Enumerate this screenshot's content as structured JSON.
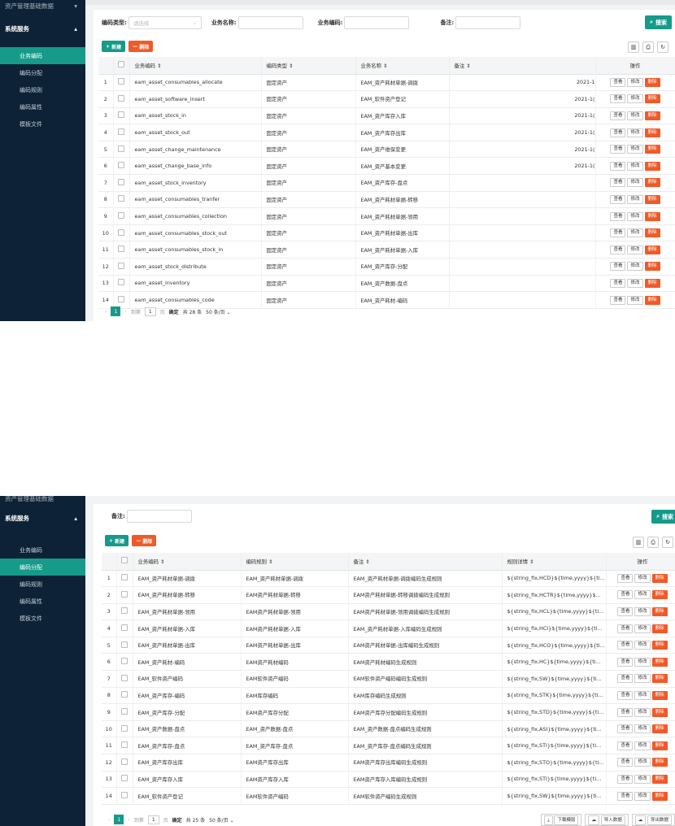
{
  "top": {
    "sidebar": {
      "group_label": "资产管理基础数据",
      "section_label": "系统服务",
      "items": [
        "业务编码",
        "编码分配",
        "编码规则",
        "编码属性",
        "模板文件"
      ],
      "active_index": 0
    },
    "filters": {
      "type_label": "编码类型:",
      "type_placeholder": "请选择",
      "name_label": "业务名称:",
      "code_label": "业务编码:",
      "remark_label": "备注:"
    },
    "search_label": "搜索",
    "add_label": "新建",
    "delete_label": "删除",
    "columns": [
      "业务编码",
      "编码类型",
      "业务名称",
      "备注",
      "",
      "操作"
    ],
    "rows": [
      {
        "n": "1",
        "code": "eam_asset_consumables_allocate",
        "type": "固定资产",
        "name": "EAM_资产耗材单据-调拨",
        "date": "2021-1"
      },
      {
        "n": "2",
        "code": "eam_asset_software_insert",
        "type": "固定资产",
        "name": "EAM_软件资产登记",
        "date": "2021-1("
      },
      {
        "n": "3",
        "code": "eam_asset_stock_in",
        "type": "固定资产",
        "name": "EAM_资产库存入库",
        "date": "2021-1("
      },
      {
        "n": "4",
        "code": "eam_asset_stock_out",
        "type": "固定资产",
        "name": "EAM_资产库存出库",
        "date": "2021-1("
      },
      {
        "n": "5",
        "code": "eam_asset_change_maintenance",
        "type": "固定资产",
        "name": "EAM_资产维保变更",
        "date": "2021-1("
      },
      {
        "n": "6",
        "code": "eam_asset_change_base_info",
        "type": "固定资产",
        "name": "EAM_资产基本变更",
        "date": "2021-1("
      },
      {
        "n": "7",
        "code": "eam_asset_stock_inventory",
        "type": "固定资产",
        "name": "EAM_资产库存-盘点",
        "date": ""
      },
      {
        "n": "8",
        "code": "eam_asset_consumables_tranfer",
        "type": "固定资产",
        "name": "EAM_资产耗材单据-转移",
        "date": ""
      },
      {
        "n": "9",
        "code": "eam_asset_consumables_collection",
        "type": "固定资产",
        "name": "EAM_资产耗材单据-领用",
        "date": ""
      },
      {
        "n": "10",
        "code": "eam_asset_consumables_stock_out",
        "type": "固定资产",
        "name": "EAM_资产耗材单据-出库",
        "date": ""
      },
      {
        "n": "11",
        "code": "eam_asset_consumables_stock_in",
        "type": "固定资产",
        "name": "EAM_资产耗材单据-入库",
        "date": ""
      },
      {
        "n": "12",
        "code": "eam_asset_stock_distribute",
        "type": "固定资产",
        "name": "EAM_资产库存-分配",
        "date": ""
      },
      {
        "n": "13",
        "code": "eam_asset_inventory",
        "type": "固定资产",
        "name": "EAM_资产数据-盘点",
        "date": ""
      },
      {
        "n": "14",
        "code": "eam_asset_consumables_code",
        "type": "固定资产",
        "name": "EAM_资产耗材-编码",
        "date": ""
      }
    ],
    "op_view": "查看",
    "op_edit": "修改",
    "op_delete": "删除",
    "pager": {
      "page": "1",
      "goto": "到第",
      "page_input": "1",
      "page_unit": "页",
      "confirm": "确定",
      "total": "共 28 条",
      "size": "50 条/页"
    }
  },
  "bottom": {
    "sidebar": {
      "group_label": "资产管理基础数据",
      "section_label": "系统服务",
      "items": [
        "业务编码",
        "编码分配",
        "编码规则",
        "编码属性",
        "模板文件"
      ],
      "active_index": 1
    },
    "filters": {
      "remark_label": "备注:"
    },
    "search_label": "搜索",
    "add_label": "新建",
    "delete_label": "删除",
    "columns": [
      "业务编码",
      "编码规则",
      "备注",
      "规则详情",
      "操作"
    ],
    "rows": [
      {
        "n": "1",
        "code": "EAM_资产耗材单据-调拨",
        "rule": "EAM_资产耗材单据-调拨",
        "remark": "EAM_资产耗材单据-调拨编码生成规则",
        "detail": "${string_fix,HCD}${time,yyyy}${ti..."
      },
      {
        "n": "2",
        "code": "EAM_资产耗材单据-转移",
        "rule": "EAM资产耗材单据-转移",
        "remark": "EAM资产耗材单据-转移调拨编码生成规则",
        "detail": "${string_fix,HCTR}${time,yyyy}$..."
      },
      {
        "n": "3",
        "code": "EAM_资产耗材单据-领用",
        "rule": "EAM资产耗材单据-领用",
        "remark": "EAM资产耗材单据-领用调拨编码生成规则",
        "detail": "${string_fix,HCL}${time,yyyy}${ti..."
      },
      {
        "n": "4",
        "code": "EAM_资产耗材单据-入库",
        "rule": "EAM资产耗材单据-入库",
        "remark": "EAM_资产耗材单据-入库编码生成规则",
        "detail": "${string_fix,HCI}${time,yyyy}${ti..."
      },
      {
        "n": "5",
        "code": "EAM_资产耗材单据-出库",
        "rule": "EAM资产耗材单据-出库",
        "remark": "EAM资产耗材单据-出库编码生成规则",
        "detail": "${string_fix,HCO}${time,yyyy}${ti..."
      },
      {
        "n": "6",
        "code": "EAM_资产耗材-编码",
        "rule": "EAM资产耗材编码",
        "remark": "EAM资产耗材编码生成规则",
        "detail": "${string_fix,HC}${time,yyyy}${ti..."
      },
      {
        "n": "7",
        "code": "EAM_软件资产编码",
        "rule": "EAM软件资产编码",
        "remark": "EAM软件资产编码编码生成规则",
        "detail": "${string_fix,SW}${time,yyyy}${ti..."
      },
      {
        "n": "8",
        "code": "EAM_资产库存-编码",
        "rule": "EAM库存编码",
        "remark": "EAM库存编码生成规则",
        "detail": "${string_fix,STK}${time,yyyy}${ti..."
      },
      {
        "n": "9",
        "code": "EAM_资产库存-分配",
        "rule": "EAM资产库存分配",
        "remark": "EAM资产库存分配编码生成规则",
        "detail": "${string_fix,STD}${time,yyyy}${ti..."
      },
      {
        "n": "10",
        "code": "EAM_资产数据-盘点",
        "rule": "EAM_资产数据-盘点",
        "remark": "EAM_资产数据-盘点编码生成规则",
        "detail": "${string_fix,ASI}${time,yyyy}${ti..."
      },
      {
        "n": "11",
        "code": "EAM_资产库存-盘点",
        "rule": "EAM_资产库存-盘点",
        "remark": "EAM_资产库存-盘点编码生成规则",
        "detail": "${string_fix,STI}${time,yyyy}${ti..."
      },
      {
        "n": "12",
        "code": "EAM_资产库存出库",
        "rule": "EAM资产库存出库",
        "remark": "EAM资产库存出库编码生成规则",
        "detail": "${string_fix,STO}${time,yyyy}${ti..."
      },
      {
        "n": "13",
        "code": "EAM_资产库存入库",
        "rule": "EAM资产库存入库",
        "remark": "EAM资产库存入库编码生成规则",
        "detail": "${string_fix,STI}${time,yyyy}${ti..."
      },
      {
        "n": "14",
        "code": "EAM_软件资产登记",
        "rule": "EAM软件资产编码",
        "remark": "EAM软件资产编码生成规则",
        "detail": "${string_fix,SW}${time,yyyy}${ti..."
      }
    ],
    "op_view": "查看",
    "op_edit": "修改",
    "op_delete": "删除",
    "pager": {
      "page": "1",
      "goto": "到第",
      "page_input": "1",
      "page_unit": "页",
      "confirm": "确定",
      "total": "共 25 条",
      "size": "50 条/页"
    },
    "export": {
      "download": "下载模版",
      "import": "导入数据",
      "export": "导出数据"
    }
  }
}
